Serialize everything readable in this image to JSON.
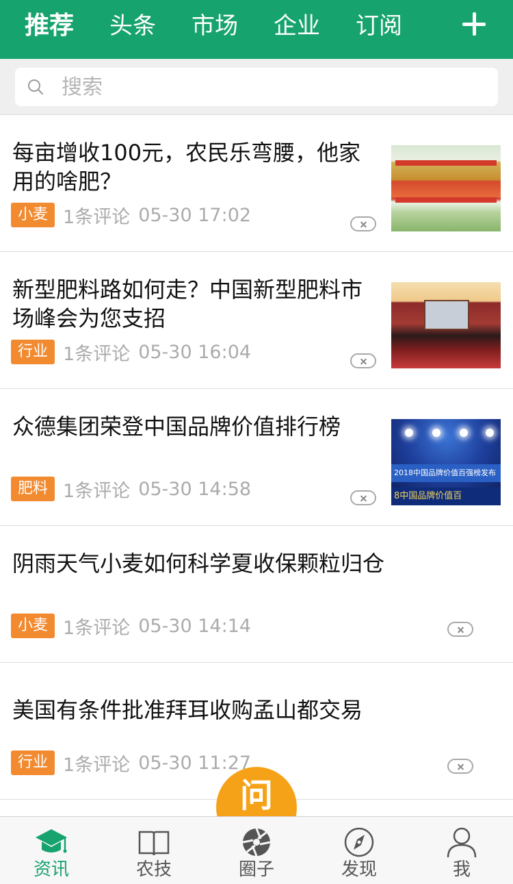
{
  "header": {
    "tabs": [
      {
        "label": "推荐",
        "active": true
      },
      {
        "label": "头条",
        "active": false
      },
      {
        "label": "市场",
        "active": false
      },
      {
        "label": "企业",
        "active": false
      },
      {
        "label": "订阅",
        "active": false
      }
    ],
    "add_icon": "plus-icon",
    "accent_color": "#17a36e"
  },
  "search": {
    "placeholder": "搜索",
    "icon": "search-icon"
  },
  "news": [
    {
      "title": "每亩增收100元，农民乐弯腰，他家用的啥肥？",
      "tag": "小麦",
      "comments": "1条评论",
      "time": "05-30 17:02",
      "has_image": true
    },
    {
      "title": "新型肥料路如何走？中国新型肥料市场峰会为您支招",
      "tag": "行业",
      "comments": "1条评论",
      "time": "05-30 16:04",
      "has_image": true
    },
    {
      "title": "众德集团荣登中国品牌价值排行榜",
      "tag": "肥料",
      "comments": "1条评论",
      "time": "05-30 14:58",
      "has_image": true,
      "image_caption_1": "2018中国品牌价值百强榜发布",
      "image_caption_2": "8中国品牌价值百"
    },
    {
      "title": "阴雨天气小麦如何科学夏收保颗粒归仓",
      "tag": "小麦",
      "comments": "1条评论",
      "time": "05-30 14:14",
      "has_image": false
    },
    {
      "title": "美国有条件批准拜耳收购孟山都交易",
      "tag": "行业",
      "comments": "1条评论",
      "time": "05-30 11:27",
      "has_image": false
    }
  ],
  "ask_button": {
    "label": "问",
    "color": "#f6a218"
  },
  "bottom_nav": [
    {
      "label": "资讯",
      "icon": "graduation-cap-icon",
      "active": true
    },
    {
      "label": "农技",
      "icon": "book-icon",
      "active": false
    },
    {
      "label": "圈子",
      "icon": "aperture-icon",
      "active": false
    },
    {
      "label": "发现",
      "icon": "compass-icon",
      "active": false
    },
    {
      "label": "我",
      "icon": "user-icon",
      "active": false
    }
  ],
  "tag_color": "#f28a30"
}
